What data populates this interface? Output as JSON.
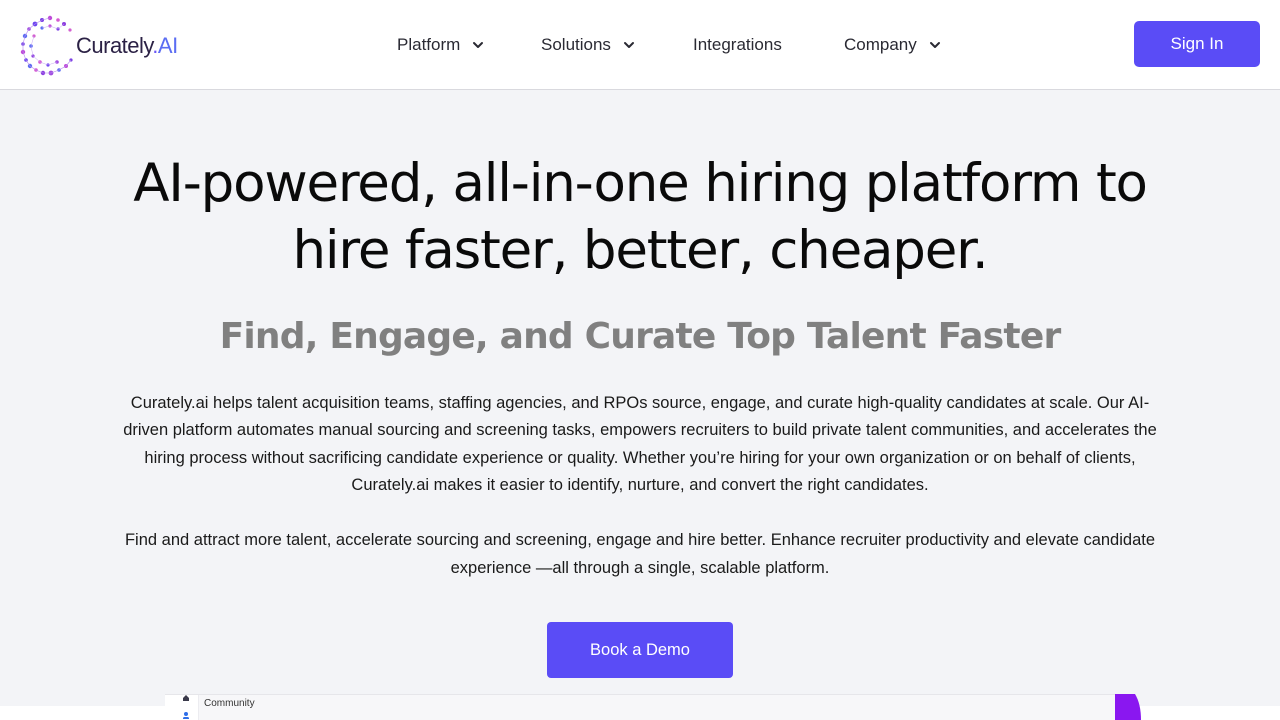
{
  "header": {
    "logo": {
      "name": "Curately",
      "dot": ".",
      "suffix": "AI"
    },
    "nav": [
      {
        "label": "Platform",
        "has_dropdown": true
      },
      {
        "label": "Solutions",
        "has_dropdown": true
      },
      {
        "label": "Integrations",
        "has_dropdown": false
      },
      {
        "label": "Company",
        "has_dropdown": true
      }
    ],
    "sign_in_label": "Sign In"
  },
  "hero": {
    "headline_line1": "AI-powered, all-in-one hiring platform to",
    "headline_line2": "hire faster, better, cheaper.",
    "subheadline": "Find, Engage, and Curate Top Talent Faster",
    "paragraph1": "Curately.ai helps talent acquisition teams, staffing agencies, and RPOs source, engage, and curate high-quality candidates at scale. Our AI-driven platform automates manual sourcing and screening tasks, empowers recruiters to build private talent communities, and accelerates the hiring process without sacrificing candidate experience or quality. Whether you’re hiring for your own organization or on behalf of clients, Curately.ai makes it easier to identify, nurture, and convert the right candidates.",
    "paragraph2": "Find and attract more talent, accelerate sourcing and screening, engage and hire better. Enhance recruiter productivity and elevate candidate experience —all through a single, scalable platform.",
    "cta_label": "Book a Demo"
  },
  "preview": {
    "section_label": "Community",
    "icons": [
      "home-icon",
      "user-icon"
    ]
  },
  "colors": {
    "brand": "#5a4cf6",
    "hero_background": "#f3f4f7",
    "subheadline": "#808080",
    "logo_text": "#2b2145"
  }
}
